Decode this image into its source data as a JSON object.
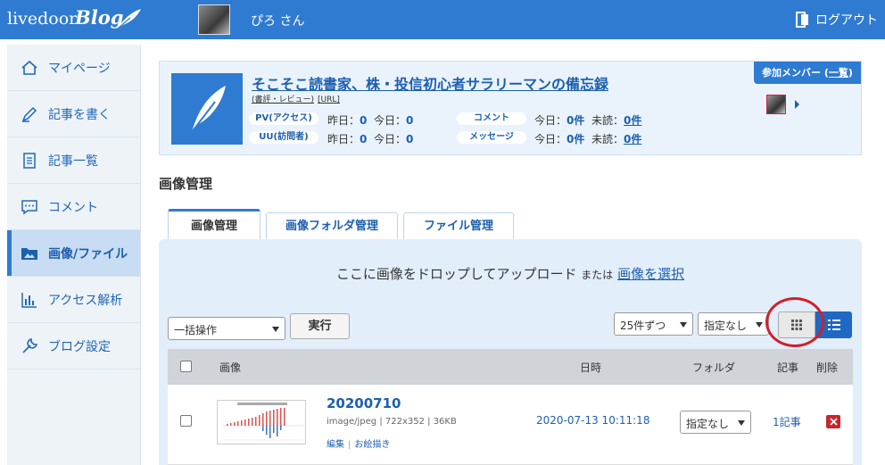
{
  "header": {
    "logo": "livedoor",
    "logo_blog": "Blog",
    "username": "ぴろ さん",
    "logout_label": "ログアウト"
  },
  "sidebar": {
    "items": [
      {
        "label": "マイページ",
        "icon": "home-icon"
      },
      {
        "label": "記事を書く",
        "icon": "pen-icon"
      },
      {
        "label": "記事一覧",
        "icon": "document-list-icon"
      },
      {
        "label": "コメント",
        "icon": "comment-icon"
      },
      {
        "label": "画像/ファイル",
        "icon": "image-folder-icon",
        "active": true
      },
      {
        "label": "アクセス解析",
        "icon": "bar-chart-icon"
      },
      {
        "label": "ブログ設定",
        "icon": "wrench-icon"
      }
    ]
  },
  "blog": {
    "title": "そこそこ読書家、株・投信初心者サラリーマンの備忘録",
    "category": "(書評・レビュー)",
    "url_label": "[URL]",
    "pv_label": "PV(アクセス)",
    "uu_label": "UU(訪問者)",
    "comment_label": "コメント",
    "message_label": "メッセージ",
    "yesterday": "昨日：",
    "today": "今日：",
    "unread": "未読：",
    "pv_yesterday": "0",
    "pv_today": "0",
    "uu_yesterday": "0",
    "uu_today": "0",
    "comment_today": "0件",
    "comment_unread": "0件",
    "message_today": "0件",
    "message_unread": "0件",
    "member_label": "参加メンバー (",
    "member_link": "一覧",
    "member_close": ")"
  },
  "main": {
    "section_title": "画像管理",
    "tabs": [
      {
        "label": "画像管理",
        "active": true
      },
      {
        "label": "画像フォルダ管理"
      },
      {
        "label": "ファイル管理"
      }
    ],
    "drop_text": "ここに画像をドロップしてアップロード",
    "drop_or": "または",
    "drop_select": "画像を選択",
    "bulk_select": "一括操作",
    "run_button": "実行",
    "per_page": "25件ずつ",
    "folder_filter": "指定なし"
  },
  "table": {
    "headers": {
      "image": "画像",
      "date": "日時",
      "folder": "フォルダ",
      "articles": "記事",
      "delete": "削除"
    },
    "rows": [
      {
        "name": "20200710",
        "meta": "image/jpeg | 722x352 | 36KB",
        "edit": "編集",
        "draw": "お絵描き",
        "date": "2020-07-13 10:11:18",
        "folder": "指定なし",
        "articles": "1記事"
      }
    ]
  },
  "colors": {
    "brand_blue": "#2f7bd2",
    "link_blue": "#1c5fae",
    "delete_red": "#c9252d",
    "highlight_circle": "#d0202a"
  }
}
